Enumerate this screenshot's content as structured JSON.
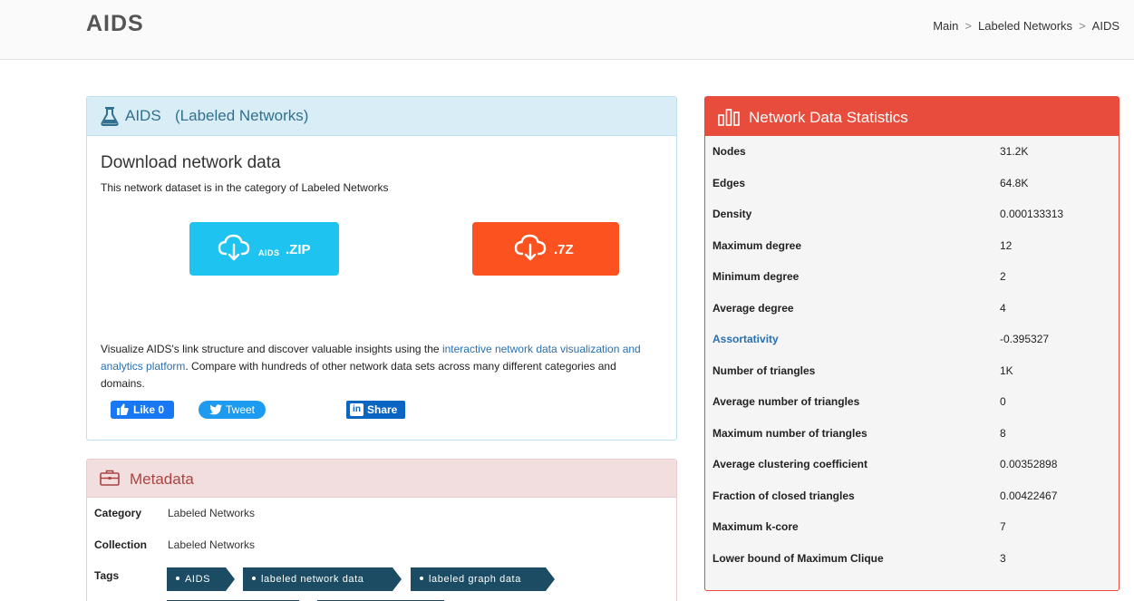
{
  "header": {
    "site_title": "AIDS",
    "breadcrumb": [
      "Main",
      "Labeled Networks",
      "AIDS"
    ],
    "breadcrumb_sep": ">"
  },
  "info_panel": {
    "title": "AIDS",
    "subtitle": "(Labeled Networks)",
    "icon": "flask-icon",
    "download_heading": "Download network data",
    "download_desc": "This network dataset is in the category of Labeled Networks",
    "zip_button": {
      "small": "AIDS",
      "big": ".ZIP",
      "color": "#1fc3f0"
    },
    "z7_button": {
      "big": ".7Z",
      "color": "#fc521f"
    },
    "viz_text_before": "Visualize AIDS's link structure and discover valuable insights using the ",
    "viz_link": "interactive network data visualization and analytics platform",
    "viz_text_after": ". Compare with hundreds of other network data sets across many different categories and domains.",
    "social": {
      "like": "Like 0",
      "tweet": "Tweet",
      "share": "Share"
    }
  },
  "metadata_panel": {
    "title": "Metadata",
    "icon": "briefcase-icon",
    "rows": [
      {
        "key": "Category",
        "value": "Labeled Networks"
      },
      {
        "key": "Collection",
        "value": "Labeled Networks"
      }
    ],
    "tags_label": "Tags",
    "tags": [
      "AIDS",
      "labeled network data",
      "labeled graph data"
    ]
  },
  "stats_panel": {
    "title": "Network Data Statistics",
    "icon": "bar-chart-icon",
    "accent": "#e74c3c",
    "rows": [
      {
        "key": "Nodes",
        "value": "31.2K"
      },
      {
        "key": "Edges",
        "value": "64.8K"
      },
      {
        "key": "Density",
        "value": "0.000133313"
      },
      {
        "key": "Maximum degree",
        "value": "12"
      },
      {
        "key": "Minimum degree",
        "value": "2"
      },
      {
        "key": "Average degree",
        "value": "4"
      },
      {
        "key": "Assortativity",
        "value": "-0.395327"
      },
      {
        "key": "Number of triangles",
        "value": "1K"
      },
      {
        "key": "Average number of triangles",
        "value": "0"
      },
      {
        "key": "Maximum number of triangles",
        "value": "8"
      },
      {
        "key": "Average clustering coefficient",
        "value": "0.00352898"
      },
      {
        "key": "Fraction of closed triangles",
        "value": "0.00422467"
      },
      {
        "key": "Maximum k-core",
        "value": "7"
      },
      {
        "key": "Lower bound of Maximum Clique",
        "value": "3"
      }
    ]
  }
}
